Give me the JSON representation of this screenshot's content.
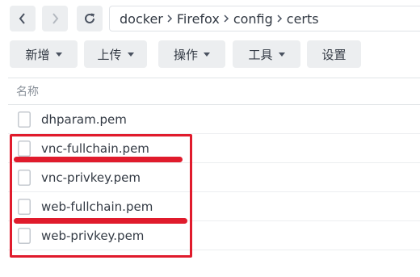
{
  "navigation": {
    "back_icon": "chevron-left-icon",
    "forward_icon": "chevron-right-icon",
    "refresh_icon": "refresh-icon"
  },
  "breadcrumb": [
    "docker",
    "Firefox",
    "config",
    "certs"
  ],
  "toolbar": {
    "new_label": "新增",
    "upload_label": "上传",
    "action_label": "操作",
    "tools_label": "工具",
    "settings_label": "设置"
  },
  "file_list": {
    "column_name": "名称",
    "files": [
      {
        "name": "dhparam.pem"
      },
      {
        "name": "vnc-fullchain.pem"
      },
      {
        "name": "vnc-privkey.pem"
      },
      {
        "name": "web-fullchain.pem"
      },
      {
        "name": "web-privkey.pem"
      }
    ]
  },
  "annotation": {
    "color": "#e01b2c"
  }
}
